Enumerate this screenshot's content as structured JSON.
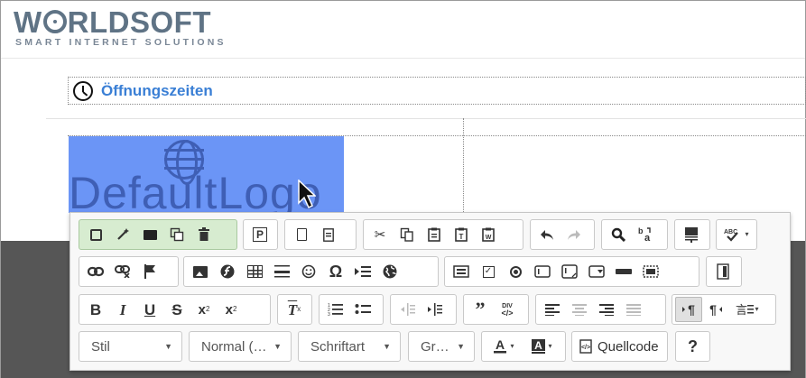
{
  "header": {
    "brand_left": "W",
    "brand_right": "RLDSOFT",
    "tagline": "SMART INTERNET SOLUTIONS"
  },
  "content": {
    "section_title": "Öffnungszeiten",
    "default_logo_text": "DefaultLogo"
  },
  "toolbar": {
    "row1": [
      {
        "name": "save-icon",
        "glyph": "💾"
      },
      {
        "name": "magic-wand-icon",
        "glyph": "⚚"
      },
      {
        "name": "folder-icon",
        "glyph": ""
      },
      {
        "name": "copy-template-icon",
        "glyph": "⧉"
      },
      {
        "name": "trash-icon",
        "glyph": "🗑"
      }
    ],
    "styles_combo": "Stil",
    "format_combo": "Normal (…",
    "font_combo": "Schriftart",
    "size_combo": "Gr…",
    "source_label": "Quellcode",
    "help_label": "?"
  },
  "colors": {
    "selection": "#6b95f6",
    "accent": "#3a7fd5",
    "brand": "#5f7385",
    "overlay": "#565656",
    "green_group": "#d7ecd0"
  }
}
